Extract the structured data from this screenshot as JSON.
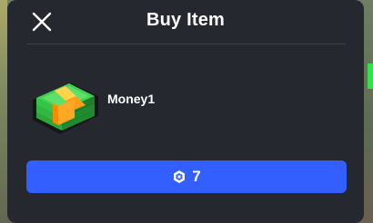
{
  "dialog": {
    "title": "Buy Item"
  },
  "item": {
    "name": "Money1",
    "icon": "cash-stack-icon"
  },
  "purchase": {
    "price": "7",
    "currency_icon": "robux-icon",
    "button_color": "#335fff"
  },
  "colors": {
    "panel": "#262830",
    "accent": "#335fff"
  }
}
